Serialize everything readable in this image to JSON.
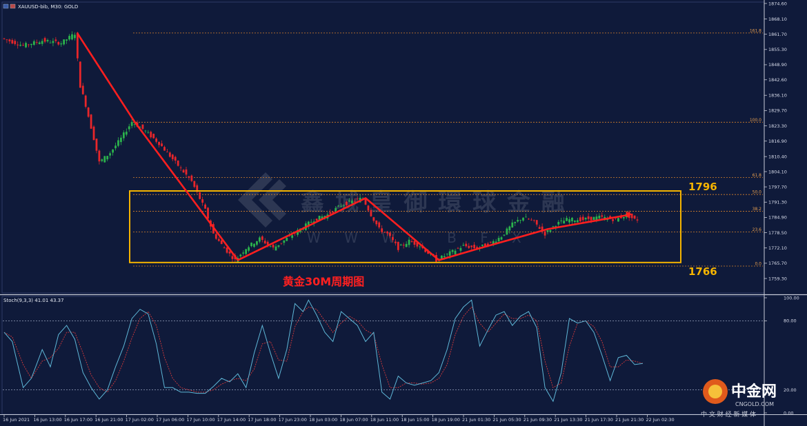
{
  "header": {
    "symbol_text": "XAUUSD-bib, M30:  GOLD"
  },
  "stoch_header": "Stoch(9,3,3) 41.01 43.37",
  "annotations": {
    "chart_title": "黄金30M周期图",
    "upper_level": "1796",
    "lower_level": "1766"
  },
  "watermark": {
    "cn": "鑫 城 皇 御 環 球 金 融",
    "en": "W W W . B F X",
    "site_cn": "中金网",
    "site_url": "CNGOLD.COM",
    "site_tagline": "中 文 财 经 新 媒 体"
  },
  "colors": {
    "background": "#0f1a3a",
    "bull": "#2bb24c",
    "bear": "#e8262a",
    "trend": "#ff1f1f",
    "box": "#f5b400",
    "stoch_main": "#5fb8d8",
    "stoch_signal": "#d83a3a",
    "fib": "#d9822b"
  },
  "chart_data": [
    {
      "type": "candlestick",
      "price_axis": [
        "1874.60",
        "1868.10",
        "1861.70",
        "1855.30",
        "1848.90",
        "1842.60",
        "1836.10",
        "1829.70",
        "1823.30",
        "1816.90",
        "1810.40",
        "1804.10",
        "1797.70",
        "1791.30",
        "1784.90",
        "1778.50",
        "1772.10",
        "1765.70",
        "1759.30"
      ],
      "time_axis": [
        "16 Jun 2021",
        "16 Jun 13:00",
        "16 Jun 17:00",
        "16 Jun 21:00",
        "17 Jun 02:00",
        "17 Jun 06:00",
        "17 Jun 10:00",
        "17 Jun 14:00",
        "17 Jun 18:00",
        "17 Jun 23:00",
        "18 Jun 03:00",
        "18 Jun 07:00",
        "18 Jun 11:00",
        "18 Jun 15:00",
        "18 Jun 19:00",
        "21 Jun 01:30",
        "21 Jun 05:30",
        "21 Jun 09:30",
        "21 Jun 13:30",
        "21 Jun 17:30",
        "21 Jun 21:30",
        "22 Jun 02:30"
      ],
      "fib_levels": [
        {
          "label": "161.8",
          "price": 1862.2
        },
        {
          "label": "100.0",
          "price": 1824.8
        },
        {
          "label": "61.8",
          "price": 1801.6
        },
        {
          "label": "50.0",
          "price": 1794.5
        },
        {
          "label": "38.2",
          "price": 1787.5
        },
        {
          "label": "23.6",
          "price": 1778.8
        },
        {
          "label": "0.0",
          "price": 1764.5
        }
      ],
      "box": {
        "top": 1796,
        "bottom": 1766
      },
      "trend_points": [
        {
          "bar": 27,
          "price": 1862
        },
        {
          "bar": 48,
          "price": 1825
        },
        {
          "bar": 86,
          "price": 1767
        },
        {
          "bar": 133,
          "price": 1793
        },
        {
          "bar": 160,
          "price": 1767
        },
        {
          "bar": 175,
          "price": 1772
        },
        {
          "bar": 200,
          "price": 1780
        },
        {
          "bar": 230,
          "price": 1786
        }
      ],
      "price_series": [
        [
          0,
          1860
        ],
        [
          8,
          1857
        ],
        [
          15,
          1859
        ],
        [
          22,
          1858
        ],
        [
          27,
          1862
        ],
        [
          29,
          1840
        ],
        [
          31,
          1832
        ],
        [
          34,
          1818
        ],
        [
          36,
          1808
        ],
        [
          40,
          1812
        ],
        [
          44,
          1818
        ],
        [
          48,
          1825
        ],
        [
          52,
          1822
        ],
        [
          58,
          1816
        ],
        [
          64,
          1808
        ],
        [
          70,
          1800
        ],
        [
          75,
          1788
        ],
        [
          78,
          1778
        ],
        [
          82,
          1772
        ],
        [
          86,
          1767
        ],
        [
          90,
          1772
        ],
        [
          95,
          1776
        ],
        [
          100,
          1772
        ],
        [
          105,
          1776
        ],
        [
          110,
          1780
        ],
        [
          115,
          1784
        ],
        [
          120,
          1786
        ],
        [
          125,
          1790
        ],
        [
          130,
          1792
        ],
        [
          133,
          1793
        ],
        [
          136,
          1786
        ],
        [
          139,
          1780
        ],
        [
          142,
          1778
        ],
        [
          146,
          1772
        ],
        [
          150,
          1775
        ],
        [
          154,
          1773
        ],
        [
          157,
          1770
        ],
        [
          160,
          1767
        ],
        [
          165,
          1770
        ],
        [
          170,
          1773
        ],
        [
          175,
          1772
        ],
        [
          180,
          1774
        ],
        [
          184,
          1777
        ],
        [
          188,
          1782
        ],
        [
          192,
          1785
        ],
        [
          196,
          1783
        ],
        [
          200,
          1778
        ],
        [
          204,
          1782
        ],
        [
          208,
          1784
        ],
        [
          214,
          1784
        ],
        [
          220,
          1785
        ],
        [
          226,
          1784
        ],
        [
          230,
          1786
        ],
        [
          233,
          1784
        ]
      ]
    },
    {
      "type": "line",
      "title": "Stoch(9,3,3) 41.01 43.37",
      "y_ticks": [
        "100.00",
        "80.00",
        "20.00",
        "0.00"
      ],
      "series": [
        {
          "name": "Main",
          "points": [
            [
              0,
              70
            ],
            [
              3,
              62
            ],
            [
              7,
              22
            ],
            [
              10,
              30
            ],
            [
              14,
              55
            ],
            [
              17,
              40
            ],
            [
              20,
              68
            ],
            [
              23,
              76
            ],
            [
              26,
              64
            ],
            [
              29,
              35
            ],
            [
              32,
              22
            ],
            [
              35,
              12
            ],
            [
              38,
              20
            ],
            [
              41,
              40
            ],
            [
              44,
              58
            ],
            [
              47,
              82
            ],
            [
              50,
              90
            ],
            [
              53,
              86
            ],
            [
              56,
              60
            ],
            [
              59,
              22
            ],
            [
              62,
              22
            ],
            [
              65,
              18
            ],
            [
              68,
              18
            ],
            [
              71,
              17
            ],
            [
              74,
              17
            ],
            [
              77,
              23
            ],
            [
              80,
              30
            ],
            [
              83,
              27
            ],
            [
              86,
              34
            ],
            [
              89,
              22
            ],
            [
              92,
              52
            ],
            [
              95,
              76
            ],
            [
              98,
              52
            ],
            [
              101,
              30
            ],
            [
              104,
              55
            ],
            [
              107,
              95
            ],
            [
              110,
              88
            ],
            [
              112,
              98
            ],
            [
              115,
              85
            ],
            [
              118,
              70
            ],
            [
              121,
              62
            ],
            [
              124,
              88
            ],
            [
              127,
              82
            ],
            [
              130,
              76
            ],
            [
              133,
              62
            ],
            [
              136,
              70
            ],
            [
              139,
              18
            ],
            [
              142,
              12
            ],
            [
              145,
              32
            ],
            [
              148,
              26
            ],
            [
              151,
              24
            ],
            [
              154,
              26
            ],
            [
              157,
              28
            ],
            [
              160,
              35
            ],
            [
              163,
              55
            ],
            [
              166,
              82
            ],
            [
              169,
              92
            ],
            [
              172,
              98
            ],
            [
              175,
              58
            ],
            [
              178,
              72
            ],
            [
              181,
              85
            ],
            [
              184,
              88
            ],
            [
              187,
              76
            ],
            [
              190,
              84
            ],
            [
              193,
              88
            ],
            [
              196,
              74
            ],
            [
              199,
              22
            ],
            [
              202,
              10
            ],
            [
              205,
              35
            ],
            [
              208,
              82
            ],
            [
              211,
              78
            ],
            [
              214,
              80
            ],
            [
              217,
              70
            ],
            [
              220,
              50
            ],
            [
              223,
              28
            ],
            [
              226,
              48
            ],
            [
              229,
              50
            ],
            [
              232,
              42
            ],
            [
              235,
              43
            ]
          ]
        },
        {
          "name": "Signal",
          "points": [
            [
              0,
              70
            ],
            [
              3,
              66
            ],
            [
              7,
              42
            ],
            [
              10,
              30
            ],
            [
              14,
              45
            ],
            [
              17,
              48
            ],
            [
              20,
              56
            ],
            [
              23,
              70
            ],
            [
              26,
              70
            ],
            [
              29,
              52
            ],
            [
              32,
              33
            ],
            [
              35,
              22
            ],
            [
              38,
              18
            ],
            [
              41,
              28
            ],
            [
              44,
              45
            ],
            [
              47,
              65
            ],
            [
              50,
              82
            ],
            [
              53,
              88
            ],
            [
              56,
              76
            ],
            [
              59,
              48
            ],
            [
              62,
              30
            ],
            [
              65,
              22
            ],
            [
              68,
              20
            ],
            [
              71,
              18
            ],
            [
              74,
              18
            ],
            [
              77,
              20
            ],
            [
              80,
              25
            ],
            [
              83,
              28
            ],
            [
              86,
              30
            ],
            [
              89,
              28
            ],
            [
              92,
              38
            ],
            [
              95,
              60
            ],
            [
              98,
              62
            ],
            [
              101,
              46
            ],
            [
              104,
              45
            ],
            [
              107,
              75
            ],
            [
              110,
              88
            ],
            [
              112,
              92
            ],
            [
              115,
              90
            ],
            [
              118,
              80
            ],
            [
              121,
              70
            ],
            [
              124,
              78
            ],
            [
              127,
              84
            ],
            [
              130,
              80
            ],
            [
              133,
              72
            ],
            [
              136,
              68
            ],
            [
              139,
              42
            ],
            [
              142,
              22
            ],
            [
              145,
              22
            ],
            [
              148,
              26
            ],
            [
              151,
              26
            ],
            [
              154,
              25
            ],
            [
              157,
              26
            ],
            [
              160,
              30
            ],
            [
              163,
              42
            ],
            [
              166,
              68
            ],
            [
              169,
              84
            ],
            [
              172,
              92
            ],
            [
              175,
              78
            ],
            [
              178,
              70
            ],
            [
              181,
              78
            ],
            [
              184,
              86
            ],
            [
              187,
              82
            ],
            [
              190,
              82
            ],
            [
              193,
              85
            ],
            [
              196,
              80
            ],
            [
              199,
              45
            ],
            [
              202,
              22
            ],
            [
              205,
              26
            ],
            [
              208,
              58
            ],
            [
              211,
              78
            ],
            [
              214,
              80
            ],
            [
              217,
              75
            ],
            [
              220,
              62
            ],
            [
              223,
              40
            ],
            [
              226,
              40
            ],
            [
              229,
              46
            ],
            [
              232,
              45
            ],
            [
              235,
              43
            ]
          ]
        }
      ]
    }
  ]
}
